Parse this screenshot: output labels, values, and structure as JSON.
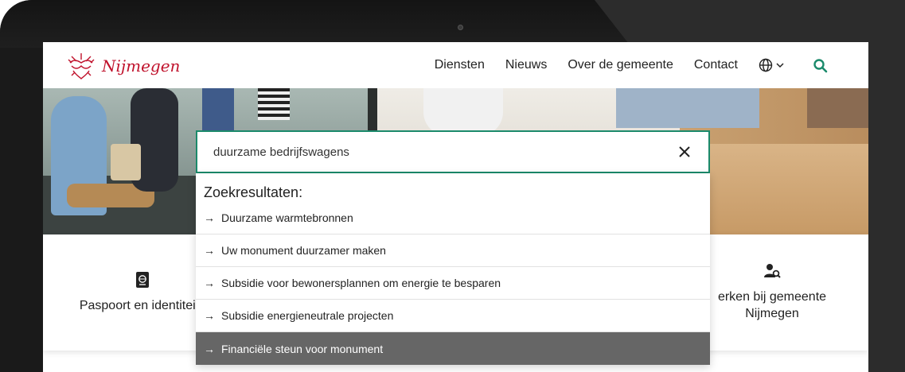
{
  "site": {
    "name": "Nijmegen",
    "brand_color": "#c0122c",
    "accent_color": "#1b8a6b"
  },
  "nav": {
    "items": [
      {
        "label": "Diensten"
      },
      {
        "label": "Nieuws"
      },
      {
        "label": "Over de gemeente"
      },
      {
        "label": "Contact"
      }
    ],
    "language_icon": "globe-icon",
    "search_icon": "search-icon"
  },
  "search": {
    "value": "duurzame bedrijfswagens",
    "clear_icon": "close-icon",
    "results_title": "Zoekresultaten:",
    "arrow": "→",
    "results": [
      {
        "label": "Duurzame warmtebronnen",
        "active": false
      },
      {
        "label": "Uw monument duurzamer maken",
        "active": false
      },
      {
        "label": "Subsidie voor bewonersplannen om energie te besparen",
        "active": false
      },
      {
        "label": "Subsidie energieneutrale projecten",
        "active": false
      },
      {
        "label": "Financiële steun voor monument",
        "active": true
      }
    ]
  },
  "cards": {
    "left": {
      "label": "Paspoort en identiteits",
      "icon": "passport-icon"
    },
    "right": {
      "label_line1": "erken bij gemeente",
      "label_line2": "Nijmegen",
      "icon": "user-search-icon"
    }
  }
}
